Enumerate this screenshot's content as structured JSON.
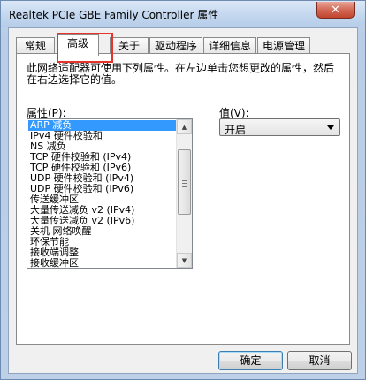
{
  "window": {
    "title": "Realtek PCIe GBE Family Controller 属性",
    "close_label": "✕"
  },
  "tabs": [
    {
      "label": "常规"
    },
    {
      "label": "高级",
      "active": true
    },
    {
      "label": "关于"
    },
    {
      "label": "驱动程序"
    },
    {
      "label": "详细信息"
    },
    {
      "label": "电源管理"
    }
  ],
  "advanced": {
    "description": "此网络适配器可使用下列属性。在左边单击您想更改的属性，然后在右边选择它的值。",
    "property_label": "属性(P):",
    "value_label": "值(V):",
    "properties": [
      "ARP 减负",
      "IPv4 硬件校验和",
      "NS 减负",
      "TCP 硬件校验和 (IPv4)",
      "TCP 硬件校验和 (IPv6)",
      "UDP 硬件校验和 (IPv4)",
      "UDP 硬件校验和 (IPv6)",
      "传送缓冲区",
      "大量传送减负 v2 (IPv4)",
      "大量传送减负 v2 (IPv6)",
      "关机 网络唤醒",
      "环保节能",
      "接收端调整",
      "接收缓冲区"
    ],
    "selected_property": "ARP 减负",
    "value_selected": "开启"
  },
  "buttons": {
    "ok": "确定",
    "cancel": "取消"
  },
  "colors": {
    "selection": "#3399ff",
    "highlight_box": "#e8332a"
  }
}
